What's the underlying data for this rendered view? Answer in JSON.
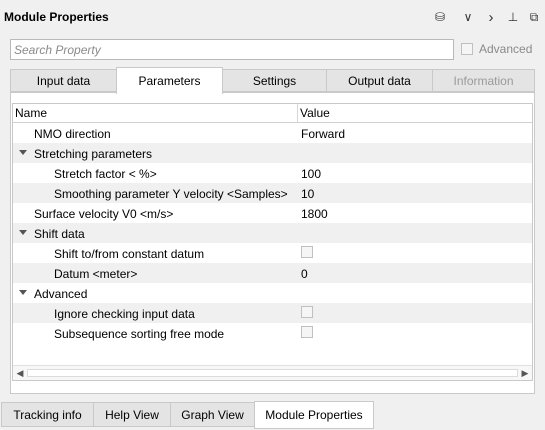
{
  "window": {
    "title": "Module Properties"
  },
  "toolbar": {
    "icons": [
      "database-icon",
      "chevron-down-icon",
      "chevron-right-icon",
      "pin-icon",
      "restore-icon"
    ],
    "glyphs": [
      "⛁",
      "∨",
      "›",
      "⊥",
      "⧉"
    ]
  },
  "search": {
    "placeholder": "Search Property",
    "value": ""
  },
  "advanced": {
    "label": "Advanced",
    "checked": false
  },
  "tabs": [
    {
      "label": "Input data",
      "active": false,
      "disabled": false
    },
    {
      "label": "Parameters",
      "active": true,
      "disabled": false
    },
    {
      "label": "Settings",
      "active": false,
      "disabled": false
    },
    {
      "label": "Output data",
      "active": false,
      "disabled": false
    },
    {
      "label": "Information",
      "active": false,
      "disabled": true
    }
  ],
  "grid": {
    "headers": {
      "name": "Name",
      "value": "Value"
    },
    "rows": [
      {
        "name": "NMO direction",
        "value": "Forward",
        "level": 1,
        "type": "text"
      },
      {
        "name": "Stretching parameters",
        "level": 0,
        "type": "group",
        "expanded": true
      },
      {
        "name": "Stretch factor < %>",
        "value": "100",
        "level": 2,
        "type": "text"
      },
      {
        "name": "Smoothing parameter Y velocity <Samples>",
        "value": "10",
        "level": 2,
        "type": "text"
      },
      {
        "name": "Surface velocity V0 <m/s>",
        "value": "1800",
        "level": 1,
        "type": "text"
      },
      {
        "name": "Shift data",
        "level": 0,
        "type": "group",
        "expanded": true
      },
      {
        "name": "Shift to/from constant datum",
        "level": 2,
        "type": "checkbox",
        "checked": false
      },
      {
        "name": "Datum <meter>",
        "value": "0",
        "level": 2,
        "type": "text"
      },
      {
        "name": "Advanced",
        "level": 0,
        "type": "group",
        "expanded": true
      },
      {
        "name": "Ignore checking input data",
        "level": 2,
        "type": "checkbox",
        "checked": false
      },
      {
        "name": "Subsequence sorting free mode",
        "level": 2,
        "type": "checkbox",
        "checked": false
      }
    ]
  },
  "bottom_tabs": [
    {
      "label": "Tracking info",
      "active": false
    },
    {
      "label": "Help View",
      "active": false
    },
    {
      "label": "Graph View",
      "active": false
    },
    {
      "label": "Module Properties",
      "active": true
    }
  ]
}
